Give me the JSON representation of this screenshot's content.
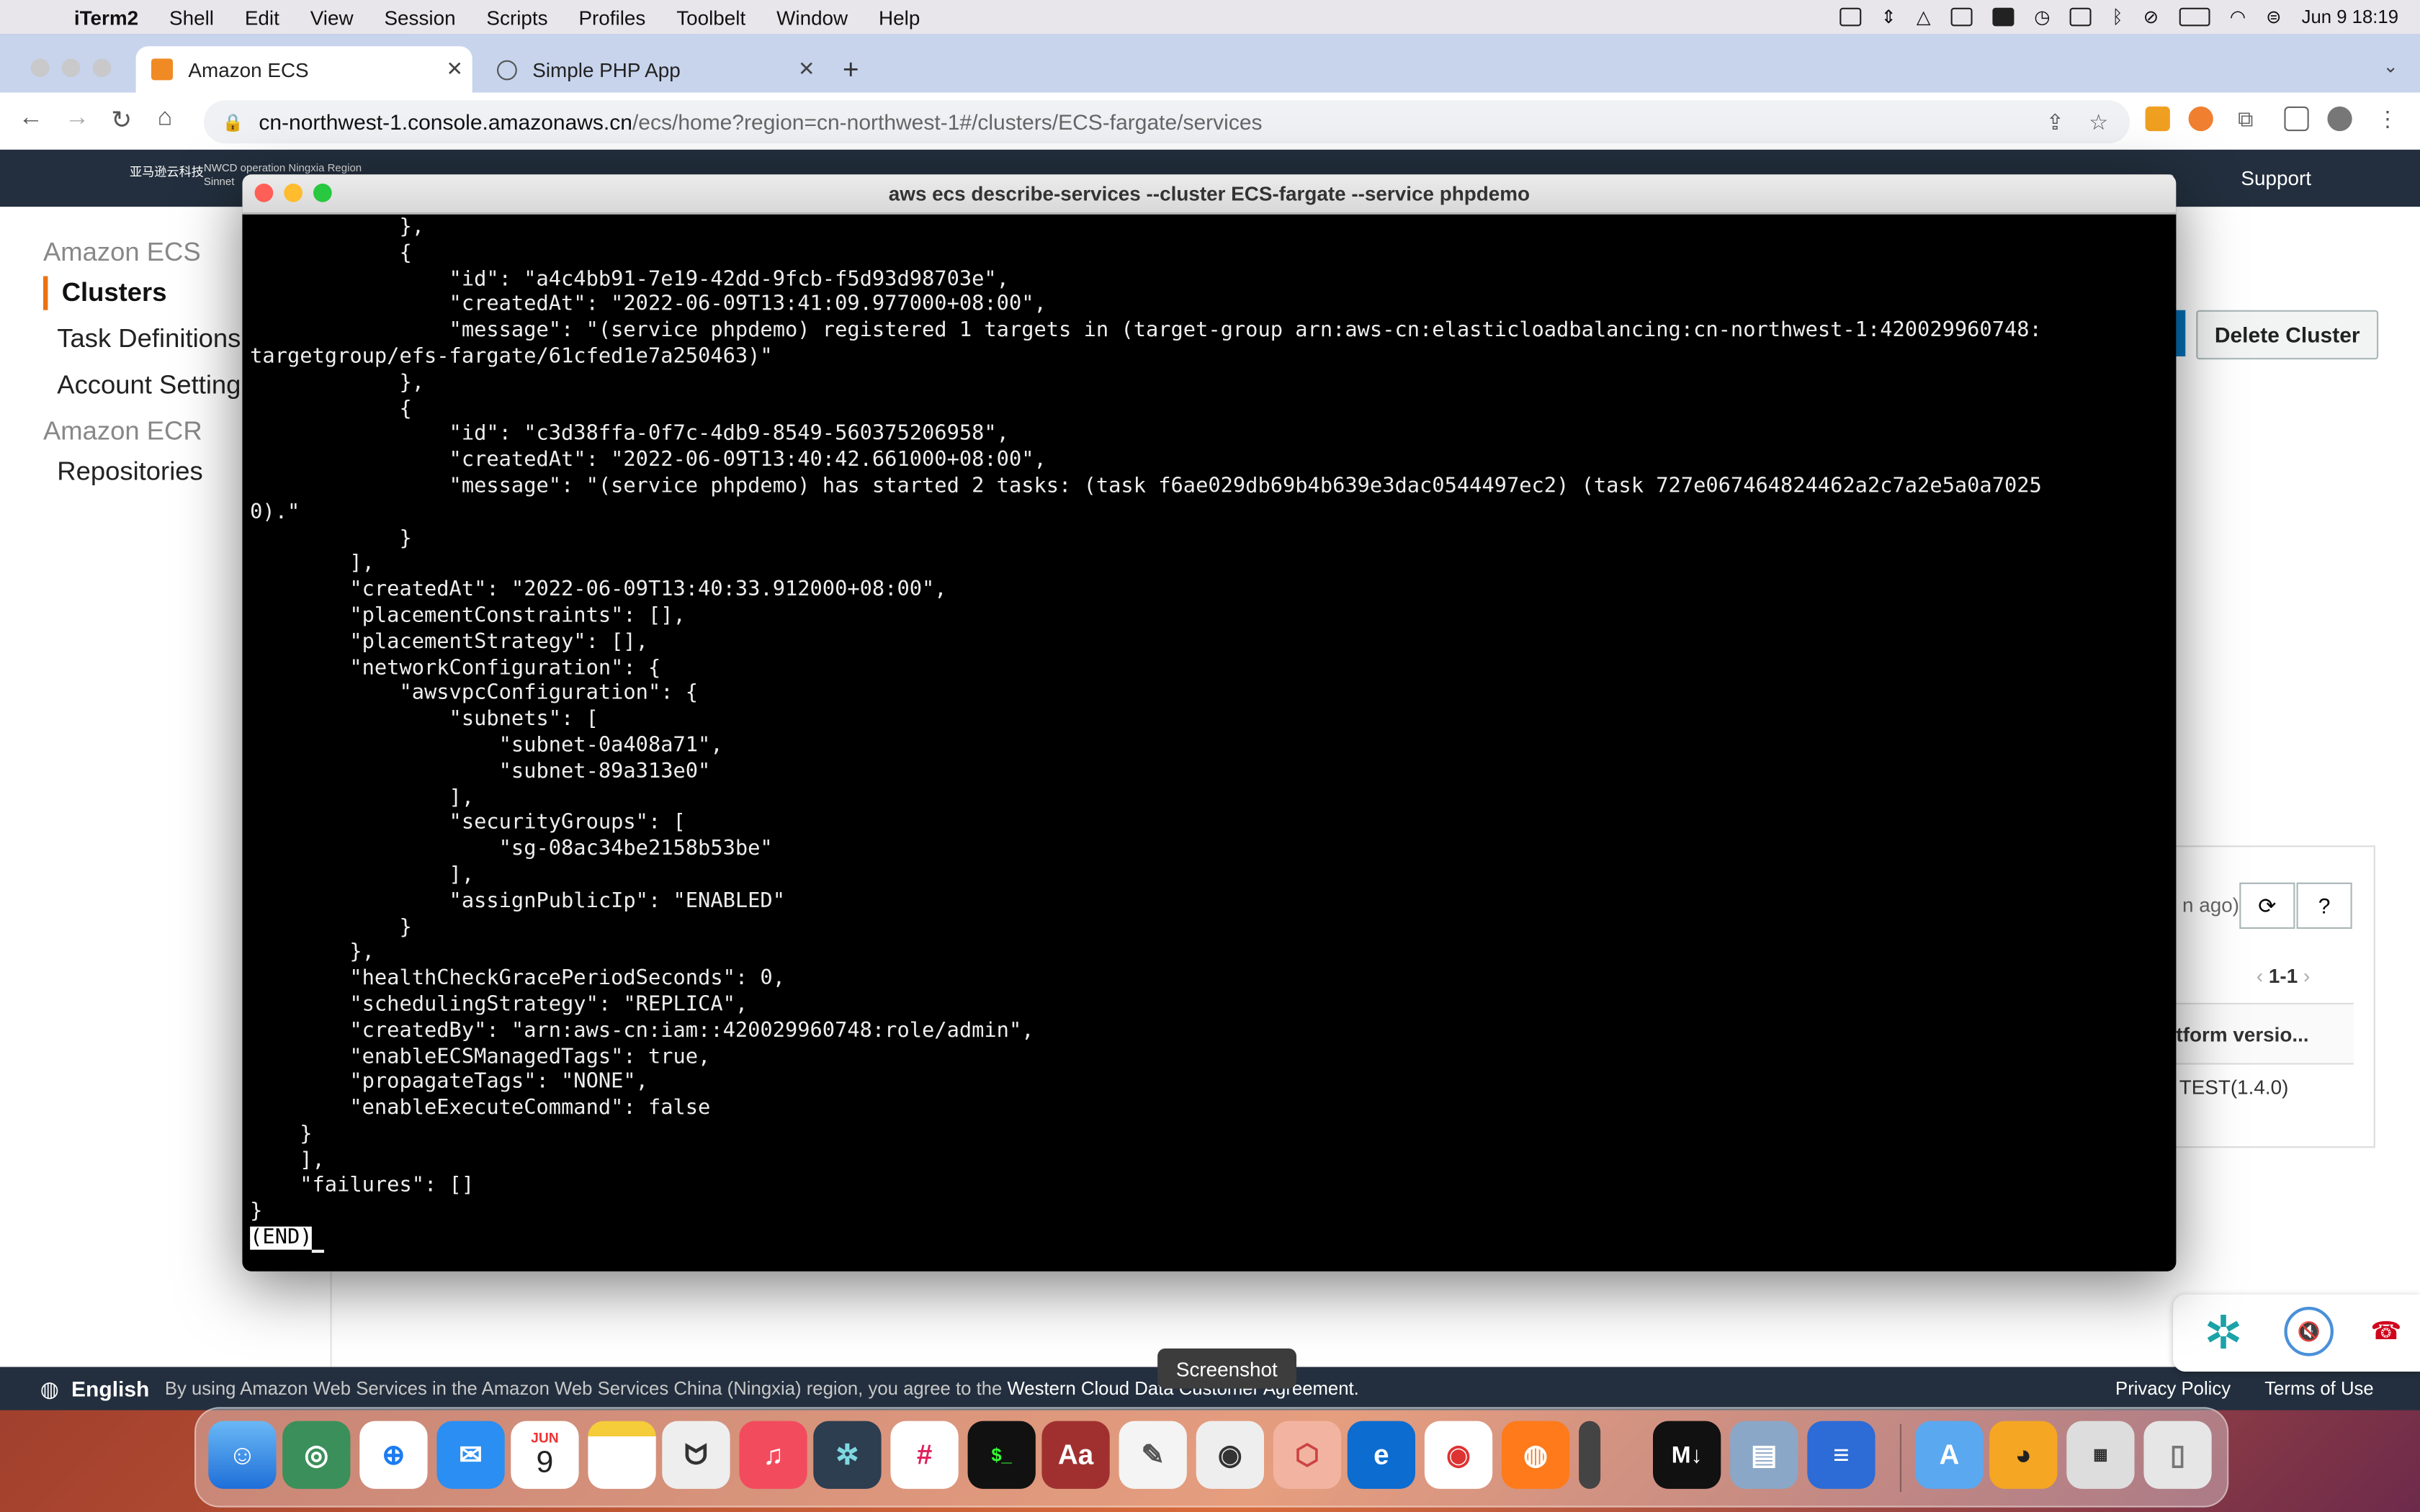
{
  "menubar": {
    "app": "iTerm2",
    "items": [
      "Shell",
      "Edit",
      "View",
      "Session",
      "Scripts",
      "Profiles",
      "Toolbelt",
      "Window",
      "Help"
    ],
    "datetime": "Jun 9  18:19"
  },
  "browser": {
    "tabs": [
      {
        "title": "Amazon ECS",
        "close": "✕"
      },
      {
        "title": "Simple PHP App",
        "close": "✕"
      }
    ],
    "new_tab": "+",
    "url_host": "cn-northwest-1.console.amazonaws.cn",
    "url_path": "/ecs/home?region=cn-northwest-1#/clusters/ECS-fargate/services"
  },
  "aws": {
    "logo_text": "亚马逊云科技",
    "region_line1": "NWCD operation Ningxia Region",
    "region_line2": "Sinnet",
    "header_partial": "e",
    "support": "Support",
    "sidenav": {
      "ecs_heading": "Amazon ECS",
      "clusters": "Clusters",
      "task_definitions": "Task Definitions",
      "account_settings": "Account Setting",
      "ecr_heading": "Amazon ECR",
      "repositories": "Repositories"
    },
    "delete_cluster": "Delete Cluster",
    "panel": {
      "ago": "n ago)",
      "pager": "1-1",
      "column_header": "tform versio...",
      "cell": "TEST(1.4.0)"
    },
    "footer": {
      "language": "English",
      "notice": "By using Amazon Web Services in the Amazon Web Services China (Ningxia) region, you agree to the ",
      "notice_link": "Western Cloud Data Customer Agreement.",
      "privacy": "Privacy Policy",
      "terms": "Terms of Use"
    }
  },
  "screenshot_tooltip": "Screenshot",
  "terminal": {
    "title": "aws ecs describe-services --cluster ECS-fargate --service phpdemo",
    "lines": [
      "            },",
      "            {",
      "                \"id\": \"a4c4bb91-7e19-42dd-9fcb-f5d93d98703e\",",
      "                \"createdAt\": \"2022-06-09T13:41:09.977000+08:00\",",
      "                \"message\": \"(service phpdemo) registered 1 targets in (target-group arn:aws-cn:elasticloadbalancing:cn-northwest-1:420029960748:",
      "targetgroup/efs-fargate/61cfed1e7a250463)\"",
      "            },",
      "            {",
      "                \"id\": \"c3d38ffa-0f7c-4db9-8549-560375206958\",",
      "                \"createdAt\": \"2022-06-09T13:40:42.661000+08:00\",",
      "                \"message\": \"(service phpdemo) has started 2 tasks: (task f6ae029db69b4b639e3dac0544497ec2) (task 727e067464824462a2c7a2e5a0a7025",
      "0).\"",
      "            }",
      "        ],",
      "        \"createdAt\": \"2022-06-09T13:40:33.912000+08:00\",",
      "        \"placementConstraints\": [],",
      "        \"placementStrategy\": [],",
      "        \"networkConfiguration\": {",
      "            \"awsvpcConfiguration\": {",
      "                \"subnets\": [",
      "                    \"subnet-0a408a71\",",
      "                    \"subnet-89a313e0\"",
      "                ],",
      "                \"securityGroups\": [",
      "                    \"sg-08ac34be2158b53be\"",
      "                ],",
      "                \"assignPublicIp\": \"ENABLED\"",
      "            }",
      "        },",
      "        \"healthCheckGracePeriodSeconds\": 0,",
      "        \"schedulingStrategy\": \"REPLICA\",",
      "        \"createdBy\": \"arn:aws-cn:iam::420029960748:role/admin\",",
      "        \"enableECSManagedTags\": true,",
      "        \"propagateTags\": \"NONE\",",
      "        \"enableExecuteCommand\": false",
      "    }",
      "    ],",
      "    \"failures\": []",
      "}"
    ],
    "end_marker": "(END)"
  },
  "dock": {
    "calendar_month": "JUN",
    "calendar_day": "9",
    "dictionary": "Aa",
    "markdown": "M↓"
  }
}
